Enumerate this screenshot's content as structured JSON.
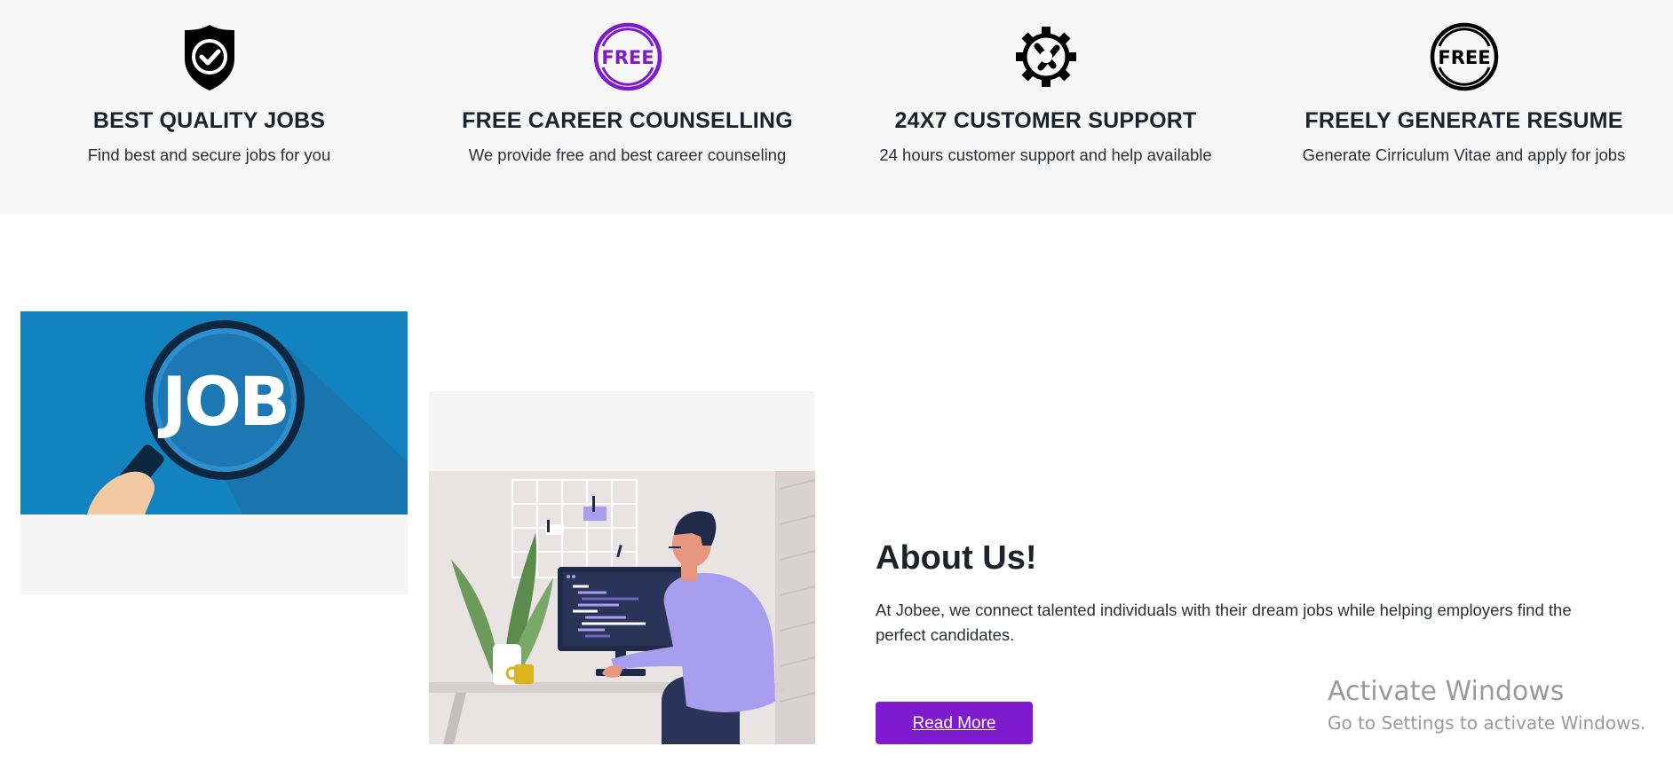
{
  "features": [
    {
      "icon": "shield-check-icon",
      "title": "BEST QUALITY JOBS",
      "description": "Find best and secure jobs for you"
    },
    {
      "icon": "free-badge-purple-icon",
      "title": "FREE CAREER COUNSELLING",
      "description": "We provide free and best career counseling"
    },
    {
      "icon": "gear-wrench-icon",
      "title": "24X7 CUSTOMER SUPPORT",
      "description": "24 hours customer support and help available"
    },
    {
      "icon": "free-badge-icon",
      "title": "FREELY GENERATE RESUME",
      "description": "Generate Cirriculum Vitae and apply for jobs"
    }
  ],
  "images": {
    "job_banner_text": "JOB"
  },
  "about": {
    "title": "About Us!",
    "text": "At Jobee, we connect talented individuals with their dream jobs while helping employers find the perfect candidates.",
    "button_label": "Read More"
  },
  "watermark": {
    "title": "Activate Windows",
    "subtitle": "Go to Settings to activate Windows."
  },
  "colors": {
    "accent": "#7e1bcf",
    "feature_bg": "#f7f7f7",
    "job_banner_bg": "#1283bf"
  },
  "free_badge_text": "FREE"
}
